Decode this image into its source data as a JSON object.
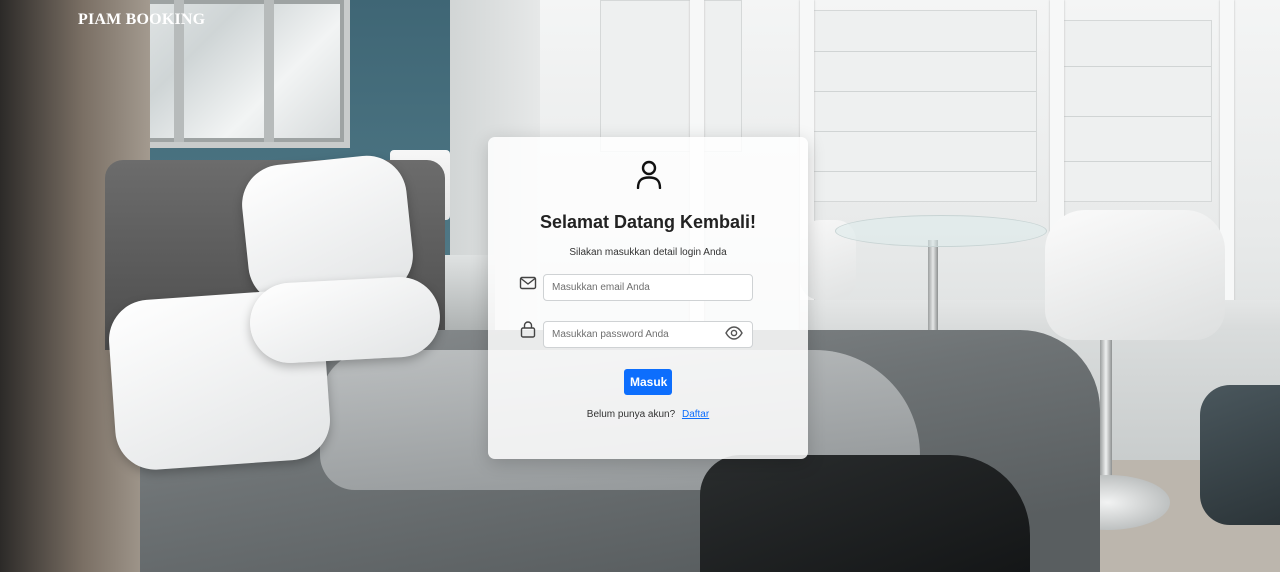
{
  "brand": {
    "name": "PIAM BOOKING"
  },
  "login": {
    "icon": "user-icon",
    "title": "Selamat Datang Kembali!",
    "subtitle": "Silakan masukkan detail login Anda",
    "email": {
      "icon": "mail-icon",
      "value": "",
      "placeholder": "Masukkan email Anda"
    },
    "password": {
      "icon": "lock-icon",
      "value": "",
      "placeholder": "Masukkan password Anda",
      "toggle_icon": "eye-icon"
    },
    "submit_label": "Masuk",
    "register_prompt": "Belum punya akun?",
    "register_link": "Daftar"
  },
  "colors": {
    "accent": "#0d6efd",
    "card_background": "#ffffff"
  }
}
